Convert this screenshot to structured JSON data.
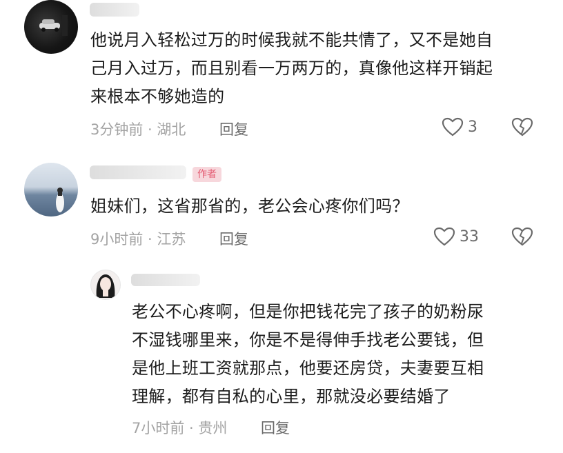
{
  "comments": [
    {
      "text": "他说月入轻松过万的时候我就不能共情了，又不是她自己月入过万，而且别看一万两万的，真像他这样开销起来根本不够她造的",
      "lines": [
        "他说月入轻松过万的时候我就不能共情了，又不是她自",
        "己月入过万，而且别看一万两万的，真像他这样开销起",
        "来根本不够她造的"
      ],
      "time": "3分钟前 · 湖北",
      "reply": "回复",
      "likes": "3"
    },
    {
      "badge": "作者",
      "text": "姐妹们，这省那省的，老公会心疼你们吗？",
      "time": "9小时前 · 江苏",
      "reply": "回复",
      "likes": "33"
    },
    {
      "lines": [
        "老公不心疼啊，但是你把钱花完了孩子的奶粉尿",
        "不湿钱哪里来，你是不是得伸手找老公要钱，但",
        "是他上班工资就那点，他要还房贷，夫妻要互相",
        "理解，都有自私的心里，那就没必要结婚了"
      ],
      "time": "7小时前 · 贵州",
      "reply": "回复"
    }
  ],
  "icons": {
    "like": "heart-outline-icon",
    "dislike": "broken-heart-icon"
  },
  "colors": {
    "badge_bg": "#f7d7dc",
    "badge_text": "#e45b72"
  }
}
